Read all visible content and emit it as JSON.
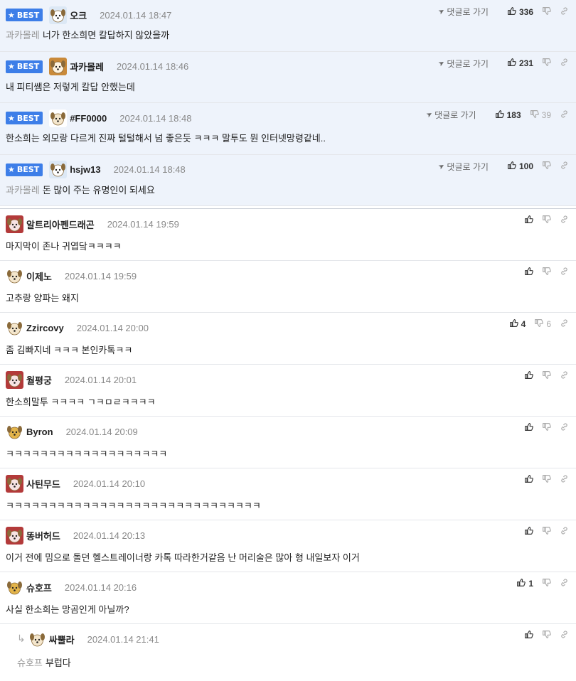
{
  "labels": {
    "best": "BEST",
    "goto": "댓글로 가기"
  },
  "best_comments": [
    {
      "nick": "오크",
      "date": "2024.01.14 18:47",
      "mention": "과카몰레",
      "text": "너가 한소희면 칼답하지 않았을까",
      "up": "336",
      "down": "",
      "avatar": "puppy-white"
    },
    {
      "nick": "과카몰레",
      "date": "2024.01.14 18:46",
      "mention": "",
      "text": "내 피티쌤은 저렇게 칼답 안했는데",
      "up": "231",
      "down": "",
      "avatar": "puppy-brown"
    },
    {
      "nick": "#FF0000",
      "date": "2024.01.14 18:48",
      "mention": "",
      "text": "한소희는 외모랑 다르게 진짜 털털해서 넘 좋은듯 ㅋㅋㅋ 말투도 뭔 인터넷망령같네..",
      "up": "183",
      "down": "39",
      "avatar": "puppy-plain"
    },
    {
      "nick": "hsjw13",
      "date": "2024.01.14 18:48",
      "mention": "과카몰레",
      "text": "돈 많이 주는 유명인이 되세요",
      "up": "100",
      "down": "",
      "avatar": "puppy-white"
    }
  ],
  "comments": [
    {
      "nick": "알트리아펜드래곤",
      "date": "2024.01.14 19:59",
      "mention": "",
      "text": "마지막이 존나 귀엽닼ㅋㅋㅋㅋ",
      "up": "",
      "down": "",
      "avatar": "puppy-red"
    },
    {
      "nick": "이제노",
      "date": "2024.01.14 19:59",
      "mention": "",
      "text": "고추랑 양파는 왜지",
      "up": "",
      "down": "",
      "avatar": "puppy-plain"
    },
    {
      "nick": "Zzircovy",
      "date": "2024.01.14 20:00",
      "mention": "",
      "text": "좀 김빠지네 ㅋㅋㅋ 본인카톡ㅋㅋ",
      "up": "4",
      "down": "6",
      "avatar": "puppy-plain"
    },
    {
      "nick": "월평궁",
      "date": "2024.01.14 20:01",
      "mention": "",
      "text": "한소희말투 ㅋㅋㅋㅋ ㄱㅋㅁㄹㅋㅋㅋㅋ",
      "up": "",
      "down": "",
      "avatar": "puppy-red"
    },
    {
      "nick": "Byron",
      "date": "2024.01.14 20:09",
      "mention": "",
      "text": "ㅋㅋㅋㅋㅋㅋㅋㅋㅋㅋㅋㅋㅋㅋㅋㅋㅋㅋㅋ",
      "up": "",
      "down": "",
      "avatar": "puppy-yellow"
    },
    {
      "nick": "사틴무드",
      "date": "2024.01.14 20:10",
      "mention": "",
      "text": "ㅋㅋㅋㅋㅋㅋㅋㅋㅋㅋㅋㅋㅋㅋㅋㅋㅋㅋㅋㅋㅋㅋㅋㅋㅋㅋㅋㅋㅋㅋ",
      "up": "",
      "down": "",
      "avatar": "puppy-red"
    },
    {
      "nick": "똥버허드",
      "date": "2024.01.14 20:13",
      "mention": "",
      "text": "이거 전에 밈으로 돌던 헬스트레이너랑 카톡 따라한거같음 난 머리술은 많아 형 내일보자 이거",
      "up": "",
      "down": "",
      "avatar": "puppy-red"
    },
    {
      "nick": "슈호프",
      "date": "2024.01.14 20:16",
      "mention": "",
      "text": "사실 한소희는 망곰인게 아닐까?",
      "up": "1",
      "down": "",
      "avatar": "puppy-yellow"
    }
  ],
  "reply": {
    "nick": "싸뿔라",
    "date": "2024.01.14 21:41",
    "mention": "슈호프",
    "text": "부럽다",
    "up": "",
    "down": "",
    "avatar": "puppy-plain"
  },
  "colors": {
    "best_bg": "#eef3fb",
    "badge": "#3d7ee8",
    "muted": "#888888"
  }
}
